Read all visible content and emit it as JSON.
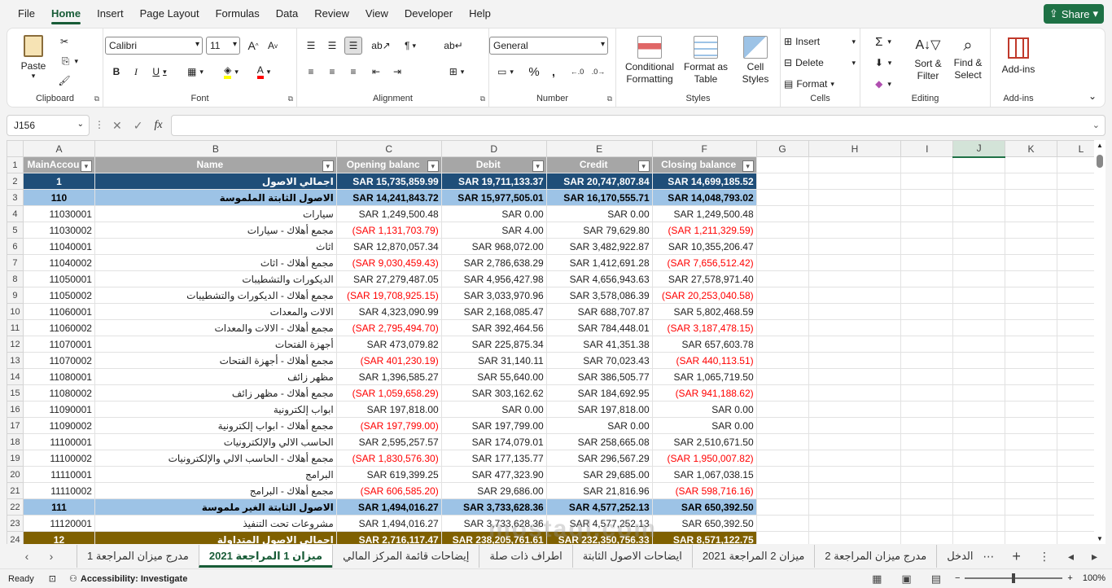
{
  "menu": {
    "tabs": [
      "File",
      "Home",
      "Insert",
      "Page Layout",
      "Formulas",
      "Data",
      "Review",
      "View",
      "Developer",
      "Help"
    ],
    "active": "Home",
    "share": "Share"
  },
  "ribbon": {
    "clipboard": {
      "label": "Clipboard",
      "paste": "Paste"
    },
    "font": {
      "label": "Font",
      "name": "Calibri",
      "size": "11"
    },
    "alignment": {
      "label": "Alignment"
    },
    "number": {
      "label": "Number",
      "format": "General"
    },
    "styles": {
      "label": "Styles",
      "conditional": "Conditional Formatting",
      "format_table": "Format as Table",
      "cell_styles": "Cell Styles"
    },
    "cells": {
      "label": "Cells",
      "insert": "Insert",
      "delete": "Delete",
      "format": "Format"
    },
    "editing": {
      "label": "Editing",
      "sort": "Sort & Filter",
      "find": "Find & Select"
    },
    "addins": {
      "label": "Add-ins",
      "button": "Add-ins"
    }
  },
  "formula_bar": {
    "name_box": "J156",
    "fx": "fx",
    "content": ""
  },
  "columns": [
    "A",
    "B",
    "C",
    "D",
    "E",
    "F",
    "G",
    "H",
    "I",
    "J",
    "K",
    "L"
  ],
  "selected_column": "J",
  "header_row": {
    "row": "1",
    "cells": [
      "MainAccou",
      "Name",
      "Opening balanc",
      "Debit",
      "Credit",
      "Closing balance"
    ]
  },
  "rows": [
    {
      "row": "2",
      "level": "lvl0",
      "acct": "1",
      "name": "اجمالي الاصول",
      "open": "SAR 15,735,859.99",
      "debit": "SAR 19,711,133.37",
      "credit": "SAR 20,747,807.84",
      "close": "SAR 14,699,185.52"
    },
    {
      "row": "3",
      "level": "lvl1",
      "acct": "110",
      "name": "الاصول الثابتة الملموسة",
      "open": "SAR 14,241,843.72",
      "debit": "SAR 15,977,505.01",
      "credit": "SAR 16,170,555.71",
      "close": "SAR 14,048,793.02"
    },
    {
      "row": "4",
      "level": "",
      "acct": "11030001",
      "name": "سيارات",
      "open": "SAR 1,249,500.48",
      "debit": "SAR 0.00",
      "credit": "SAR 0.00",
      "close": "SAR 1,249,500.48"
    },
    {
      "row": "5",
      "level": "",
      "acct": "11030002",
      "name": "مجمع أهلاك - سيارات",
      "open": "(SAR 1,131,703.79)",
      "debit": "SAR 4.00",
      "credit": "SAR 79,629.80",
      "close": "(SAR 1,211,329.59)"
    },
    {
      "row": "6",
      "level": "",
      "acct": "11040001",
      "name": "اثاث",
      "open": "SAR 12,870,057.34",
      "debit": "SAR 968,072.00",
      "credit": "SAR 3,482,922.87",
      "close": "SAR 10,355,206.47"
    },
    {
      "row": "7",
      "level": "",
      "acct": "11040002",
      "name": "مجمع أهلاك - اثاث",
      "open": "(SAR 9,030,459.43)",
      "debit": "SAR 2,786,638.29",
      "credit": "SAR 1,412,691.28",
      "close": "(SAR 7,656,512.42)"
    },
    {
      "row": "8",
      "level": "",
      "acct": "11050001",
      "name": "الديكورات والتشطيبات",
      "open": "SAR 27,279,487.05",
      "debit": "SAR 4,956,427.98",
      "credit": "SAR 4,656,943.63",
      "close": "SAR 27,578,971.40"
    },
    {
      "row": "9",
      "level": "",
      "acct": "11050002",
      "name": "مجمع أهلاك - الديكورات والتشطيبات",
      "open": "(SAR 19,708,925.15)",
      "debit": "SAR 3,033,970.96",
      "credit": "SAR 3,578,086.39",
      "close": "(SAR 20,253,040.58)"
    },
    {
      "row": "10",
      "level": "",
      "acct": "11060001",
      "name": "الالات والمعدات",
      "open": "SAR 4,323,090.99",
      "debit": "SAR 2,168,085.47",
      "credit": "SAR 688,707.87",
      "close": "SAR 5,802,468.59"
    },
    {
      "row": "11",
      "level": "",
      "acct": "11060002",
      "name": "مجمع أهلاك - الالات والمعدات",
      "open": "(SAR 2,795,494.70)",
      "debit": "SAR 392,464.56",
      "credit": "SAR 784,448.01",
      "close": "(SAR 3,187,478.15)"
    },
    {
      "row": "12",
      "level": "",
      "acct": "11070001",
      "name": "أجهزة الفتحات",
      "open": "SAR 473,079.82",
      "debit": "SAR 225,875.34",
      "credit": "SAR 41,351.38",
      "close": "SAR 657,603.78"
    },
    {
      "row": "13",
      "level": "",
      "acct": "11070002",
      "name": "مجمع أهلاك - أجهزة الفتحات",
      "open": "(SAR 401,230.19)",
      "debit": "SAR 31,140.11",
      "credit": "SAR 70,023.43",
      "close": "(SAR 440,113.51)"
    },
    {
      "row": "14",
      "level": "",
      "acct": "11080001",
      "name": "مظهر زائف",
      "open": "SAR 1,396,585.27",
      "debit": "SAR 55,640.00",
      "credit": "SAR 386,505.77",
      "close": "SAR 1,065,719.50"
    },
    {
      "row": "15",
      "level": "",
      "acct": "11080002",
      "name": "مجمع أهلاك - مظهر زائف",
      "open": "(SAR 1,059,658.29)",
      "debit": "SAR 303,162.62",
      "credit": "SAR 184,692.95",
      "close": "(SAR 941,188.62)"
    },
    {
      "row": "16",
      "level": "",
      "acct": "11090001",
      "name": "ابواب إلكترونية",
      "open": "SAR 197,818.00",
      "debit": "SAR 0.00",
      "credit": "SAR 197,818.00",
      "close": "SAR 0.00"
    },
    {
      "row": "17",
      "level": "",
      "acct": "11090002",
      "name": "مجمع أهلاك - ابواب إلكترونية",
      "open": "(SAR 197,799.00)",
      "debit": "SAR 197,799.00",
      "credit": "SAR 0.00",
      "close": "SAR 0.00"
    },
    {
      "row": "18",
      "level": "",
      "acct": "11100001",
      "name": "الحاسب الالي والإلكترونيات",
      "open": "SAR 2,595,257.57",
      "debit": "SAR 174,079.01",
      "credit": "SAR 258,665.08",
      "close": "SAR 2,510,671.50"
    },
    {
      "row": "19",
      "level": "",
      "acct": "11100002",
      "name": "مجمع أهلاك - الحاسب الالي والإلكترونيات",
      "open": "(SAR 1,830,576.30)",
      "debit": "SAR 177,135.77",
      "credit": "SAR 296,567.29",
      "close": "(SAR 1,950,007.82)"
    },
    {
      "row": "20",
      "level": "",
      "acct": "11110001",
      "name": "البرامج",
      "open": "SAR 619,399.25",
      "debit": "SAR 477,323.90",
      "credit": "SAR 29,685.00",
      "close": "SAR 1,067,038.15"
    },
    {
      "row": "21",
      "level": "",
      "acct": "11110002",
      "name": "مجمع أهلاك - البرامج",
      "open": "(SAR 606,585.20)",
      "debit": "SAR 29,686.00",
      "credit": "SAR 21,816.96",
      "close": "(SAR 598,716.16)"
    },
    {
      "row": "22",
      "level": "lvl1",
      "acct": "111",
      "name": "الاصول الثابتة الغير ملموسة",
      "open": "SAR 1,494,016.27",
      "debit": "SAR 3,733,628.36",
      "credit": "SAR 4,577,252.13",
      "close": "SAR 650,392.50"
    },
    {
      "row": "23",
      "level": "",
      "acct": "11120001",
      "name": "مشروعات تحت التنفيذ",
      "open": "SAR 1,494,016.27",
      "debit": "SAR 3,733,628.36",
      "credit": "SAR 4,577,252.13",
      "close": "SAR 650,392.50"
    },
    {
      "row": "24",
      "level": "lvl2",
      "acct": "12",
      "name": "اجمالي الاصول المتداولة",
      "open": "SAR 2,716,117.47",
      "debit": "SAR 238,205,761.61",
      "credit": "SAR 232,350,756.33",
      "close": "SAR 8,571,122.75"
    }
  ],
  "sheet_tabs": [
    "مدرج ميزان المراجعة 1",
    "ميزان 1 المراجعة 2021",
    "إيضاحات قائمة المركز المالي",
    "اطراف ذات صلة",
    "ايضاحات الاصول الثابتة",
    "ميزان 2 المراجعة 2021",
    "مدرج ميزان المراجعة 2",
    "الدخل"
  ],
  "active_sheet": "ميزان 1 المراجعة 2021",
  "status": {
    "ready": "Ready",
    "accessibility": "Accessibility: Investigate",
    "zoom": "100%"
  },
  "watermark": "mostaql.com"
}
